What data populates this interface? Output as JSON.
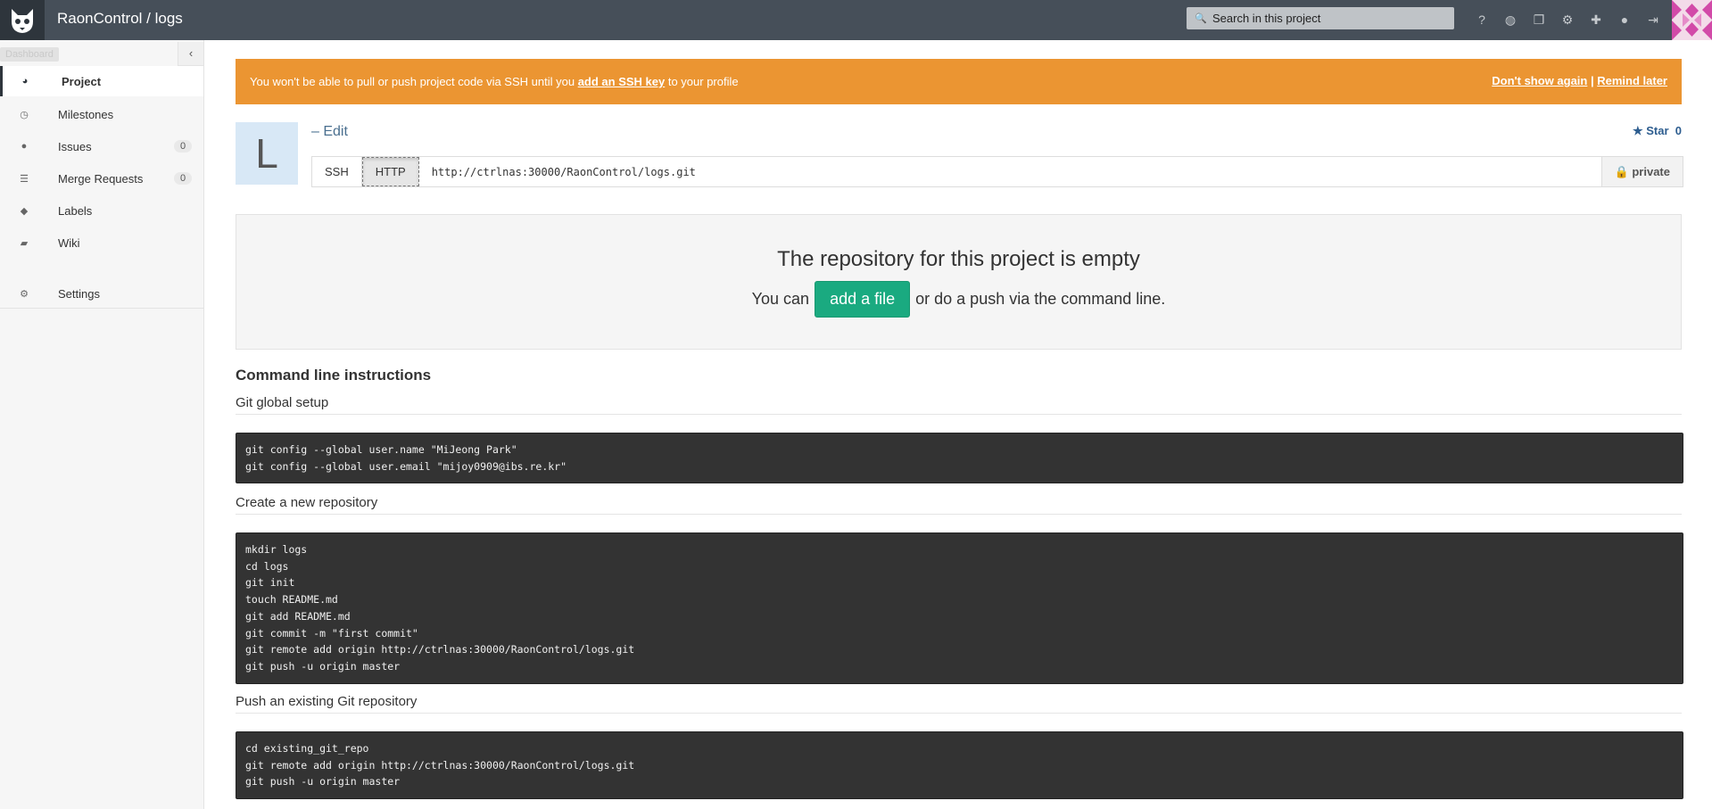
{
  "header": {
    "title": "RaonControl / logs",
    "search_placeholder": "Search in this project",
    "icons": [
      "help-icon",
      "globe-icon",
      "copy-icon",
      "gears-icon",
      "plus-icon",
      "user-icon",
      "sign-out-icon"
    ]
  },
  "sidebar": {
    "tooltip": "Dashboard",
    "items": [
      {
        "label": "Project",
        "icon": "dashboard-icon",
        "active": true
      },
      {
        "label": "Milestones",
        "icon": "clock-icon"
      },
      {
        "label": "Issues",
        "icon": "exclamation-circle-icon",
        "count": "0"
      },
      {
        "label": "Merge Requests",
        "icon": "tasks-icon",
        "count": "0"
      },
      {
        "label": "Labels",
        "icon": "tags-icon"
      },
      {
        "label": "Wiki",
        "icon": "book-icon"
      },
      {
        "label": "Settings",
        "icon": "cogs-icon"
      }
    ]
  },
  "alert": {
    "text_before": "You won't be able to pull or push project code via SSH until you ",
    "link": "add an SSH key",
    "text_after": " to your profile",
    "dont_show": "Don't show again",
    "separator": "|",
    "remind": "Remind later"
  },
  "project": {
    "avatar_letter": "L",
    "edit": "– Edit",
    "star": "Star",
    "star_count": "0",
    "ssh": "SSH",
    "http": "HTTP",
    "clone_url": "http://ctrlnas:30000/RaonControl/logs.git",
    "visibility": "private"
  },
  "empty": {
    "title": "The repository for this project is empty",
    "before": "You can",
    "button": "add a file",
    "after": "or do a push via the command line."
  },
  "instructions": {
    "title": "Command line instructions",
    "sections": [
      {
        "heading": "Git global setup",
        "code": "git config --global user.name \"MiJeong Park\"\ngit config --global user.email \"mijoy0909@ibs.re.kr\""
      },
      {
        "heading": "Create a new repository",
        "code": "mkdir logs\ncd logs\ngit init\ntouch README.md\ngit add README.md\ngit commit -m \"first commit\"\ngit remote add origin http://ctrlnas:30000/RaonControl/logs.git\ngit push -u origin master"
      },
      {
        "heading": "Push an existing Git repository",
        "code": "cd existing_git_repo\ngit remote add origin http://ctrlnas:30000/RaonControl/logs.git\ngit push -u origin master"
      }
    ]
  },
  "colors": {
    "header": "#464f59",
    "alert": "#eb9532",
    "add_file": "#1aaa80",
    "code_bg": "#333333"
  }
}
